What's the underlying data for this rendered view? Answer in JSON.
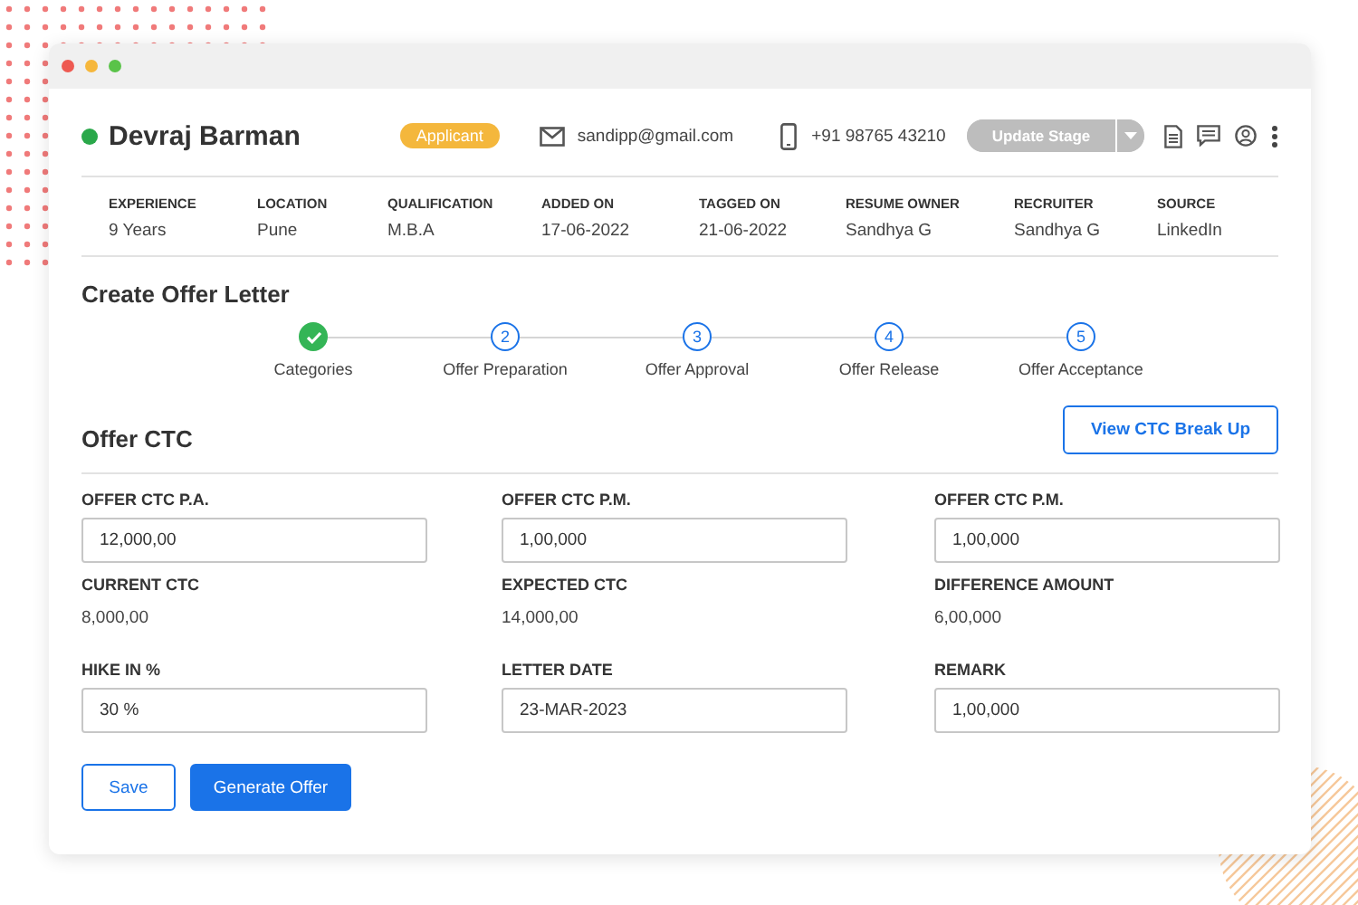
{
  "candidate": {
    "name": "Devraj Barman",
    "badge": "Applicant",
    "email": "sandipp@gmail.com",
    "phone": "+91 98765 43210",
    "stage_button": {
      "label": "Update Stage",
      "disabled": true
    }
  },
  "details": [
    {
      "label": "EXPERIENCE",
      "value": "9 Years"
    },
    {
      "label": "LOCATION",
      "value": "Pune"
    },
    {
      "label": "QUALIFICATION",
      "value": "M.B.A"
    },
    {
      "label": "ADDED ON",
      "value": "17-06-2022"
    },
    {
      "label": "TAGGED ON",
      "value": "21-06-2022"
    },
    {
      "label": "RESUME OWNER",
      "value": "Sandhya G"
    },
    {
      "label": "RECRUITER",
      "value": "Sandhya G"
    },
    {
      "label": "SOURCE",
      "value": "LinkedIn"
    }
  ],
  "page_title": "Create Offer Letter",
  "steps": [
    {
      "label": "Categories",
      "done": true
    },
    {
      "label": "Offer Preparation",
      "number": "2",
      "done": false
    },
    {
      "label": "Offer Approval",
      "number": "3",
      "done": false
    },
    {
      "label": "Offer Release",
      "number": "4",
      "done": false
    },
    {
      "label": "Offer Acceptance",
      "number": "5",
      "done": false
    }
  ],
  "section_title": "Offer CTC",
  "breakup_button": "View CTC Break Up",
  "fields": [
    {
      "label": "OFFER CTC P.A.",
      "value": "12,000,00",
      "kind": "input"
    },
    {
      "label": "OFFER CTC P.M.",
      "value": "1,00,000",
      "kind": "input"
    },
    {
      "label": "OFFER CTC P.M.",
      "value": "1,00,000",
      "kind": "input"
    },
    {
      "label": "CURRENT CTC",
      "value": "8,000,00",
      "kind": "text"
    },
    {
      "label": "EXPECTED CTC",
      "value": "14,000,00",
      "kind": "text"
    },
    {
      "label": "DIFFERENCE AMOUNT",
      "value": "6,00,000",
      "kind": "text"
    },
    {
      "label": "HIKE IN %",
      "value": "30 %",
      "kind": "input"
    },
    {
      "label": "LETTER DATE",
      "value": "23-MAR-2023",
      "kind": "input"
    },
    {
      "label": "REMARK",
      "value": "1,00,000",
      "kind": "input"
    }
  ],
  "actions": [
    {
      "label": "Save",
      "kind": "outline"
    },
    {
      "label": "Generate Offer",
      "kind": "primary"
    }
  ]
}
